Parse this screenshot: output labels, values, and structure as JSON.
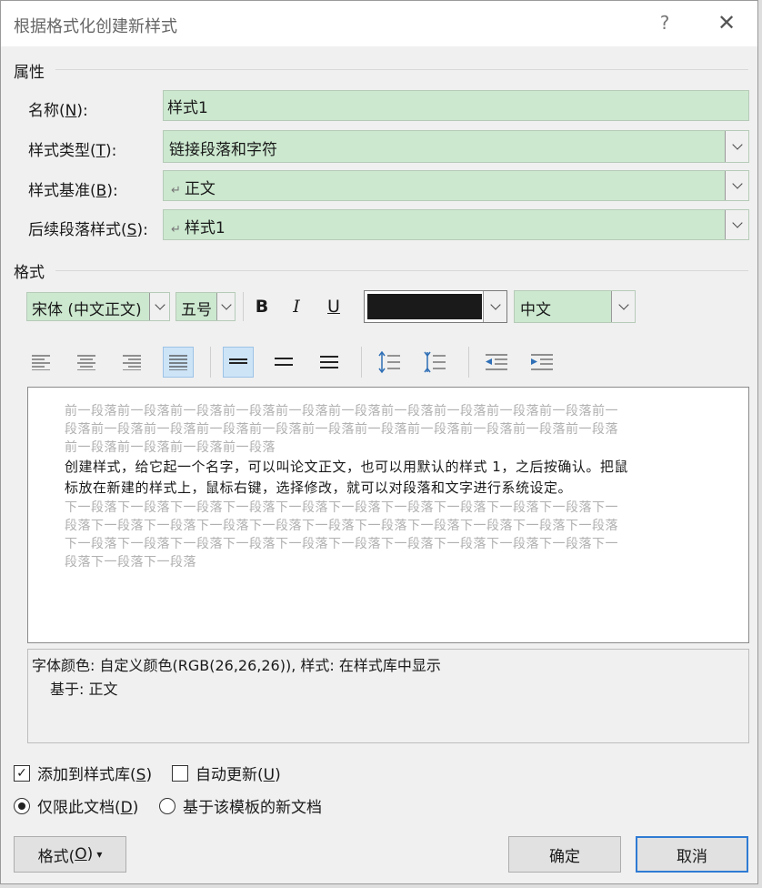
{
  "dialog": {
    "title": "根据格式化创建新样式",
    "help_glyph": "?",
    "close_glyph": "✕"
  },
  "properties": {
    "group_label": "属性",
    "name": {
      "label": "名称(",
      "hotkey": "N",
      "suffix": "):",
      "value": "样式1"
    },
    "style_type": {
      "label": "样式类型(",
      "hotkey": "T",
      "suffix": "):",
      "value": "链接段落和字符"
    },
    "based_on": {
      "label": "样式基准(",
      "hotkey": "B",
      "suffix": "):",
      "value": "正文"
    },
    "next_style": {
      "label": "后续段落样式(",
      "hotkey": "S",
      "suffix": "):",
      "value": "样式1"
    },
    "para_mark": "↵"
  },
  "format": {
    "group_label": "格式",
    "font": "宋体 (中文正文)",
    "size": "五号",
    "bold": "B",
    "italic": "I",
    "underline": "U",
    "font_color": "#1a1a1a",
    "script": "中文"
  },
  "preview": {
    "prev_lines": [
      "前一段落前一段落前一段落前一段落前一段落前一段落前一段落前一段落前一段落前一段落前一",
      "段落前一段落前一段落前一段落前一段落前一段落前一段落前一段落前一段落前一段落前一段落",
      "前一段落前一段落前一段落前一段落"
    ],
    "main_lines": [
      "创建样式，给它起一个名字，可以叫论文正文，也可以用默认的样式 1，之后按确认。把鼠",
      "标放在新建的样式上，鼠标右键，选择修改，就可以对段落和文字进行系统设定。"
    ],
    "next_lines": [
      "下一段落下一段落下一段落下一段落下一段落下一段落下一段落下一段落下一段落下一段落下一",
      "段落下一段落下一段落下一段落下一段落下一段落下一段落下一段落下一段落下一段落下一段落",
      "下一段落下一段落下一段落下一段落下一段落下一段落下一段落下一段落下一段落下一段落下一",
      "段落下一段落下一段落"
    ]
  },
  "description": {
    "line1": "字体颜色: 自定义颜色(RGB(26,26,26)), 样式: 在样式库中显示",
    "line2": "基于: 正文"
  },
  "options": {
    "add_to_gallery": {
      "label": "添加到样式库(",
      "hotkey": "S",
      "suffix": ")",
      "checked": true,
      "check_glyph": "✓"
    },
    "auto_update": {
      "label": "自动更新(",
      "hotkey": "U",
      "suffix": ")",
      "checked": false
    },
    "only_this_doc": {
      "label": "仅限此文档(",
      "hotkey": "D",
      "suffix": ")",
      "selected": true
    },
    "new_docs_template": {
      "label": "基于该模板的新文档",
      "selected": false
    }
  },
  "buttons": {
    "format": {
      "label": "格式(",
      "hotkey": "O",
      "suffix": ")",
      "arrow": "▾"
    },
    "ok": "确定",
    "cancel": "取消"
  },
  "colors": {
    "field_bg": "#cce8cf",
    "selected_btn": "#cde4f7",
    "default_btn_border": "#2f7bd4"
  }
}
